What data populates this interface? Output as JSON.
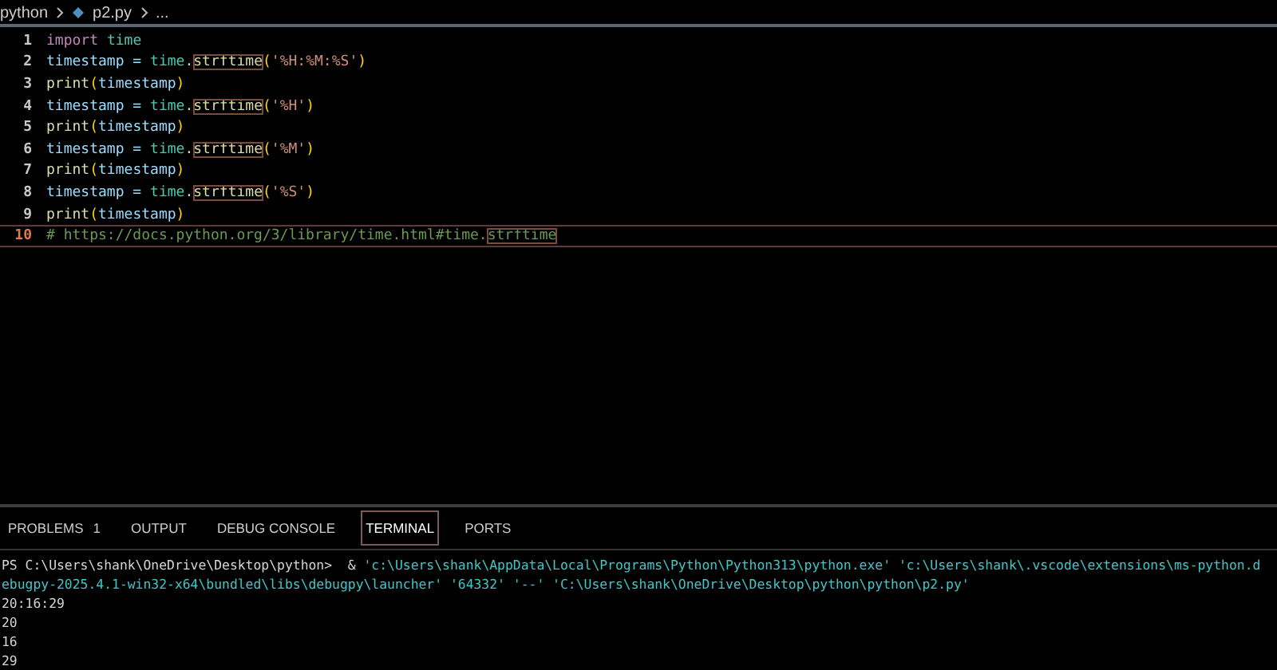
{
  "breadcrumb": {
    "folder": "python",
    "file": "p2.py",
    "more": "..."
  },
  "editor": {
    "lines": [
      {
        "number": "1",
        "current": false,
        "tokens": [
          {
            "text": "import ",
            "kind": "keyword"
          },
          {
            "text": "time",
            "kind": "module"
          }
        ]
      },
      {
        "number": "2",
        "current": false,
        "tokens": [
          {
            "text": "timestamp = ",
            "kind": "variable"
          },
          {
            "text": "time",
            "kind": "module"
          },
          {
            "text": ".",
            "kind": "plain"
          },
          {
            "text": "strftime",
            "kind": "match"
          },
          {
            "text": "(",
            "kind": "paren"
          },
          {
            "text": "'%H:%M:%S'",
            "kind": "string"
          },
          {
            "text": ")",
            "kind": "paren"
          }
        ]
      },
      {
        "number": "3",
        "current": false,
        "tokens": [
          {
            "text": "print",
            "kind": "function"
          },
          {
            "text": "(",
            "kind": "paren"
          },
          {
            "text": "timestamp",
            "kind": "variable"
          },
          {
            "text": ")",
            "kind": "paren"
          }
        ]
      },
      {
        "number": "4",
        "current": false,
        "tokens": [
          {
            "text": "timestamp = ",
            "kind": "variable"
          },
          {
            "text": "time",
            "kind": "module"
          },
          {
            "text": ".",
            "kind": "plain"
          },
          {
            "text": "strftime",
            "kind": "match"
          },
          {
            "text": "(",
            "kind": "paren"
          },
          {
            "text": "'%H'",
            "kind": "string"
          },
          {
            "text": ")",
            "kind": "paren"
          }
        ]
      },
      {
        "number": "5",
        "current": false,
        "tokens": [
          {
            "text": "print",
            "kind": "function"
          },
          {
            "text": "(",
            "kind": "paren"
          },
          {
            "text": "timestamp",
            "kind": "variable"
          },
          {
            "text": ")",
            "kind": "paren"
          }
        ]
      },
      {
        "number": "6",
        "current": false,
        "tokens": [
          {
            "text": "timestamp = ",
            "kind": "variable"
          },
          {
            "text": "time",
            "kind": "module"
          },
          {
            "text": ".",
            "kind": "plain"
          },
          {
            "text": "strftime",
            "kind": "match"
          },
          {
            "text": "(",
            "kind": "paren"
          },
          {
            "text": "'%M'",
            "kind": "string"
          },
          {
            "text": ")",
            "kind": "paren"
          }
        ]
      },
      {
        "number": "7",
        "current": false,
        "tokens": [
          {
            "text": "print",
            "kind": "function"
          },
          {
            "text": "(",
            "kind": "paren"
          },
          {
            "text": "timestamp",
            "kind": "variable"
          },
          {
            "text": ")",
            "kind": "paren"
          }
        ]
      },
      {
        "number": "8",
        "current": false,
        "tokens": [
          {
            "text": "timestamp = ",
            "kind": "variable"
          },
          {
            "text": "time",
            "kind": "module"
          },
          {
            "text": ".",
            "kind": "plain"
          },
          {
            "text": "strftime",
            "kind": "match"
          },
          {
            "text": "(",
            "kind": "paren"
          },
          {
            "text": "'%S'",
            "kind": "string"
          },
          {
            "text": ")",
            "kind": "paren"
          }
        ]
      },
      {
        "number": "9",
        "current": false,
        "tokens": [
          {
            "text": "print",
            "kind": "function"
          },
          {
            "text": "(",
            "kind": "paren"
          },
          {
            "text": "timestamp",
            "kind": "variable"
          },
          {
            "text": ")",
            "kind": "paren"
          }
        ]
      },
      {
        "number": "10",
        "current": true,
        "tokens": [
          {
            "text": "# https://docs.python.org/3/library/time.html#time.",
            "kind": "comment"
          },
          {
            "text": "strftime",
            "kind": "comment-match"
          }
        ]
      }
    ]
  },
  "panel": {
    "tabs": [
      {
        "label": "PROBLEMS",
        "badge": "1",
        "selected": false
      },
      {
        "label": "OUTPUT",
        "selected": false
      },
      {
        "label": "DEBUG CONSOLE",
        "selected": false
      },
      {
        "label": "TERMINAL",
        "selected": true
      },
      {
        "label": "PORTS",
        "selected": false
      }
    ],
    "terminal_lines": [
      [
        {
          "text": "PS C:\\Users\\shank\\OneDrive\\Desktop\\python>  & ",
          "kind": "plain"
        },
        {
          "text": "'c:\\Users\\shank\\AppData\\Local\\Programs\\Python\\Python313\\python.exe' 'c:\\Users\\shank\\.vscode\\extensions\\ms-python.d",
          "kind": "path"
        }
      ],
      [
        {
          "text": "ebugpy-2025.4.1-win32-x64\\bundled\\libs\\debugpy\\launcher' '64332' '--' 'C:\\Users\\shank\\OneDrive\\Desktop\\python\\python\\p2.py'",
          "kind": "path"
        }
      ],
      [
        {
          "text": "20:16:29",
          "kind": "plain"
        }
      ],
      [
        {
          "text": "20",
          "kind": "plain"
        }
      ],
      [
        {
          "text": "16",
          "kind": "plain"
        }
      ],
      [
        {
          "text": "29",
          "kind": "plain"
        }
      ]
    ]
  }
}
